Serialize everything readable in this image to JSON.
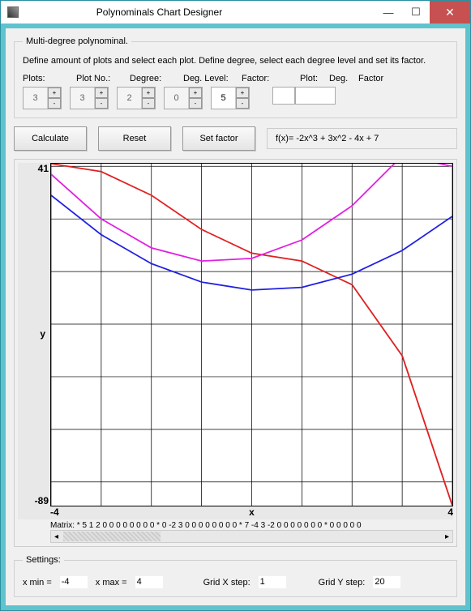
{
  "window": {
    "title": "Polynominals Chart Designer"
  },
  "group1": {
    "legend": "Multi-degree polynominal.",
    "desc": "Define amount of plots and select each plot. Define degree, select each degree level and set its factor.",
    "labels": {
      "plots": "Plots:",
      "plotno": "Plot No.:",
      "degree": "Degree:",
      "deglevel": "Deg. Level:",
      "factor": "Factor:",
      "plot": "Plot:",
      "deg": "Deg.",
      "fact": "Factor"
    },
    "values": {
      "plots": "3",
      "plotno": "3",
      "degree": "2",
      "deglevel": "0",
      "factor": "5",
      "plot": "",
      "deg": "",
      "fact": ""
    }
  },
  "buttons": {
    "calculate": "Calculate",
    "reset": "Reset",
    "setfactor": "Set factor"
  },
  "formula": "f(x)= -2x^3 + 3x^2 - 4x + 7",
  "chart_data": {
    "type": "line",
    "xlim": [
      -4,
      4
    ],
    "ylim": [
      -89,
      41
    ],
    "xlabel": "x",
    "ylabel": "y",
    "grid_x_step": 1,
    "grid_y_step": 20,
    "series": [
      {
        "name": "red",
        "color": "#e02020",
        "x": [
          -4,
          -3,
          -2,
          -1,
          0,
          1,
          2,
          3,
          4
        ],
        "values": [
          41,
          38,
          29,
          16,
          7,
          4,
          -5,
          -32,
          -89
        ]
      },
      {
        "name": "blue",
        "color": "#2020e0",
        "x": [
          -4,
          -3,
          -2,
          -1,
          0,
          1,
          2,
          3,
          4
        ],
        "values": [
          29,
          14,
          3,
          -4,
          -7,
          -6,
          -1,
          8,
          21
        ]
      },
      {
        "name": "magenta",
        "color": "#e020e0",
        "x": [
          -4,
          -3,
          -2,
          -1,
          0,
          1,
          2,
          3,
          4
        ],
        "values": [
          37,
          20,
          9,
          4,
          5,
          12,
          25,
          44,
          40
        ]
      }
    ],
    "matrix_text": "Matrix: * 5 1 2 0 0 0 0 0 0 0 0   * 0 -2 3 0 0 0 0 0 0 0 0   * 7 -4 3 -2 0 0 0 0 0 0 0   * 0 0 0 0 0"
  },
  "settings": {
    "legend": "Settings:",
    "xmin_label": "x min =",
    "xmin": "-4",
    "xmax_label": "x max =",
    "xmax": "4",
    "gx_label": "Grid X step:",
    "gx": "1",
    "gy_label": "Grid Y step:",
    "gy": "20"
  }
}
